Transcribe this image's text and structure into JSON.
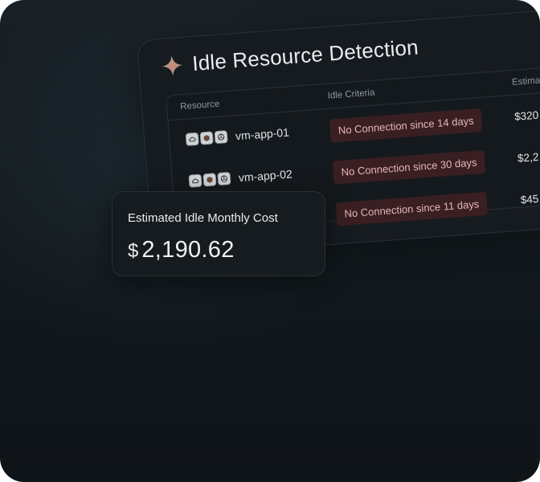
{
  "panel": {
    "title": "Idle Resource Detection",
    "icon": "sparkle-icon",
    "columns": {
      "resource": "Resource",
      "criteria": "Idle Criteria",
      "cost": "Estimat"
    },
    "rows": [
      {
        "name": "vm-app-01",
        "criteria": "No Connection since 14 days",
        "cost": "$320"
      },
      {
        "name": "vm-app-02",
        "criteria": "No Connection since 30 days",
        "cost": "$2,2"
      },
      {
        "name": "",
        "criteria": "No Connection since 11 days",
        "cost": "$45"
      }
    ],
    "resource_icons": [
      "cloud-icon",
      "hexagon-icon",
      "network-icon"
    ]
  },
  "summary": {
    "label": "Estimated Idle Monthly Cost",
    "currency": "$",
    "amount": "2,190.62"
  },
  "colors": {
    "background": "#12191d",
    "card": "#161b20",
    "badge_bg": "#3a1f22",
    "badge_text": "#e3b7b5"
  }
}
